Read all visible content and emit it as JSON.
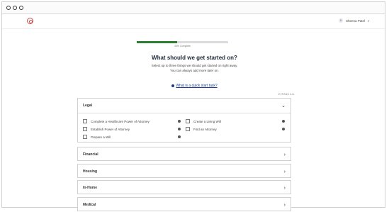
{
  "browser": {
    "controls": [
      "circle",
      "circle",
      "circle"
    ]
  },
  "app": {
    "logo_icon": "circle-logo-icon"
  },
  "user": {
    "initial": "S",
    "name": "Sheena Patel",
    "menu_icon": "chevron-down-icon"
  },
  "progress": {
    "fraction": 0.44,
    "label": "44% Complete",
    "fill_color": "#2e7d32"
  },
  "main": {
    "heading": "What should we get started on?",
    "subtitle_1": "Select up to three things we should get started on right away.",
    "subtitle_2": "You can always add more later on.",
    "quick_link": "What is a quick start task?",
    "expand_all": "EXPAND ALL"
  },
  "sections": {
    "legal": {
      "title": "Legal",
      "options": [
        "Complete a Healthcare Power of Attorney",
        "Create a Living Will",
        "Establish Power of Attorney",
        "Find an Attorney",
        "Prepare a Will"
      ]
    },
    "financial": {
      "title": "Financial"
    },
    "housing": {
      "title": "Housing"
    },
    "inhome": {
      "title": "In-Home"
    },
    "medical": {
      "title": "Medical"
    }
  }
}
